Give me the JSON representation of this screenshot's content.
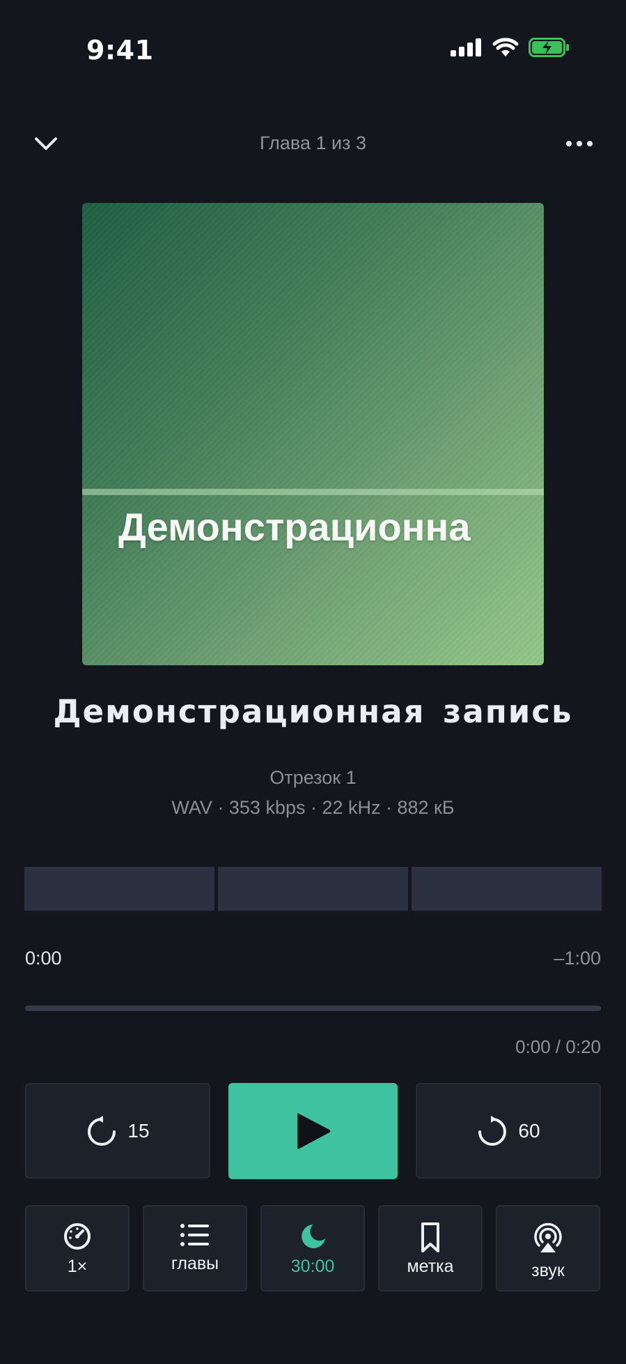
{
  "status_bar": {
    "time": "9:41"
  },
  "header": {
    "chapter": "Глава 1 из 3"
  },
  "artwork": {
    "text": "Демонстрационна"
  },
  "track": {
    "title": "Демонстрационная  запись",
    "segment": "Отрезок 1",
    "file_info": "WAV · 353 kbps · 22 kHz · 882 кБ"
  },
  "segments_count": 3,
  "playback": {
    "elapsed": "0:00",
    "remaining": "–1:00",
    "progress": 0,
    "segment_time": "0:00 / 0:20"
  },
  "controls": {
    "back_seconds": "15",
    "forward_seconds": "60"
  },
  "tools": [
    {
      "label": "1×",
      "icon": "speed-gauge-icon"
    },
    {
      "label": "главы",
      "icon": "list-icon"
    },
    {
      "label": "30:00",
      "icon": "moon-icon",
      "active": true
    },
    {
      "label": "метка",
      "icon": "bookmark-icon"
    },
    {
      "label": "звук",
      "icon": "airplay-audio-icon"
    }
  ],
  "colors": {
    "background": "#13161c",
    "accent": "#3fc29f",
    "panel": "#1d2129",
    "segment": "#2b3140",
    "muted_text": "#8e939c"
  }
}
